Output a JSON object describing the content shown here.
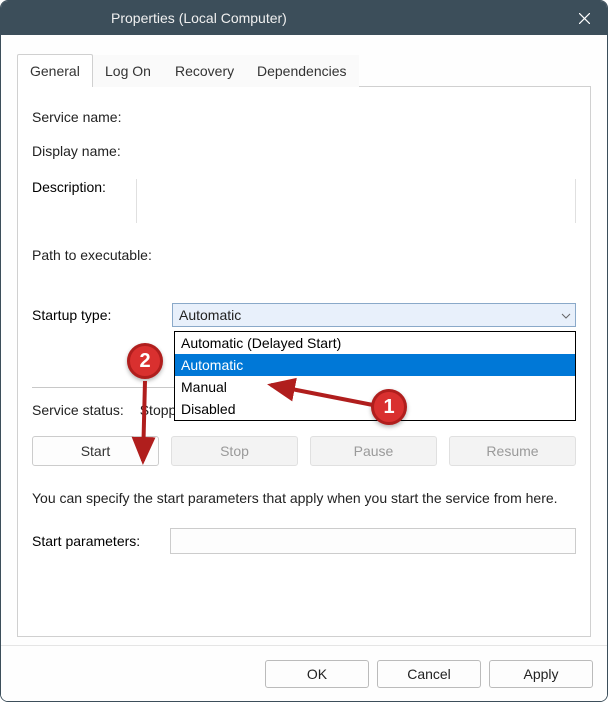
{
  "window": {
    "title": "Properties (Local Computer)"
  },
  "tabs": {
    "t1": "General",
    "t2": "Log On",
    "t3": "Recovery",
    "t4": "Dependencies"
  },
  "labels": {
    "service_name": "Service name:",
    "display_name": "Display name:",
    "description": "Description:",
    "path": "Path to executable:",
    "startup_type": "Startup type:",
    "service_status": "Service status:",
    "start_params": "Start parameters:"
  },
  "startup": {
    "selected": "Automatic",
    "options": {
      "o0": "Automatic (Delayed Start)",
      "o1": "Automatic",
      "o2": "Manual",
      "o3": "Disabled"
    }
  },
  "status": {
    "value": "Stopped"
  },
  "buttons": {
    "start": "Start",
    "stop": "Stop",
    "pause": "Pause",
    "resume": "Resume",
    "ok": "OK",
    "cancel": "Cancel",
    "apply": "Apply"
  },
  "hint": "You can specify the start parameters that apply when you start the service from here.",
  "annotations": {
    "badge1": "1",
    "badge2": "2"
  },
  "colors": {
    "titlebar": "#3c4e5a",
    "dropdown_highlight": "#0078d7",
    "annotation_red": "#d9302f"
  }
}
